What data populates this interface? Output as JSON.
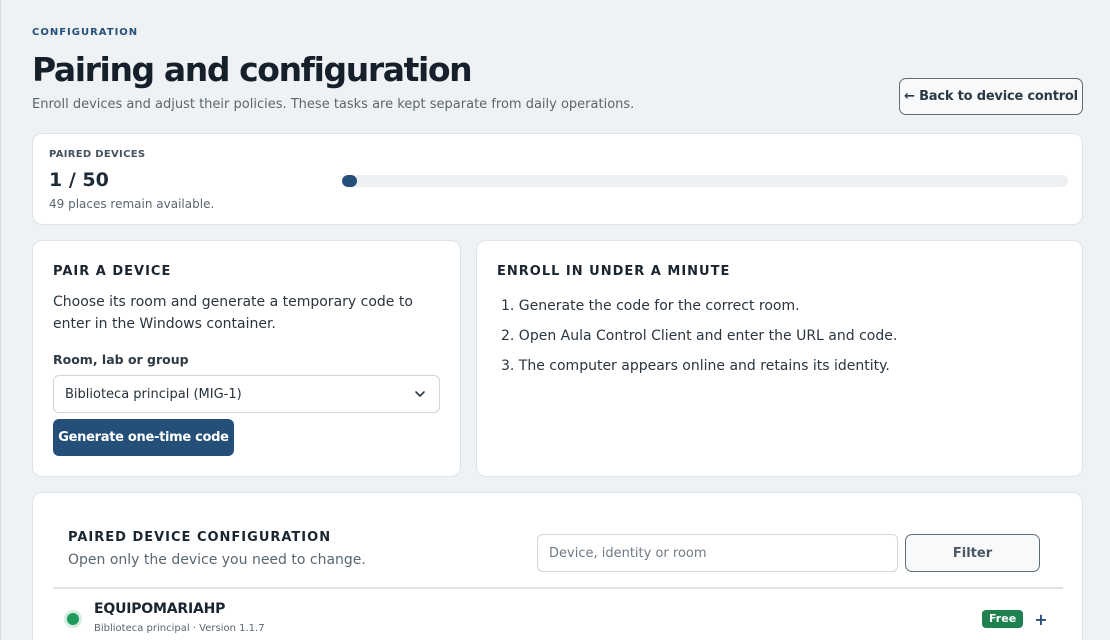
{
  "header": {
    "eyebrow": "CONFIGURATION",
    "title": "Pairing and configuration",
    "subtitle": "Enroll devices and adjust their policies. These tasks are kept separate from daily operations.",
    "back_label": "← Back to device control"
  },
  "stats": {
    "label": "PAIRED DEVICES",
    "value": "1 / 50",
    "note": "49 places remain available.",
    "paired": 1,
    "capacity": 50,
    "accent": "#244f78"
  },
  "pair": {
    "heading": "PAIR A DEVICE",
    "description": "Choose its room and generate a temporary code to enter in the Windows container.",
    "field_label": "Room, lab or group",
    "selected_room": "Biblioteca principal (MIG-1)",
    "button_label": "Generate one-time code"
  },
  "enroll": {
    "heading": "ENROLL IN UNDER A MINUTE",
    "steps": [
      "1. Generate the code for the correct room.",
      "2. Open Aula Control Client and enter the URL and code.",
      "3. The computer appears online and retains its identity."
    ]
  },
  "config": {
    "heading": "PAIRED DEVICE CONFIGURATION",
    "subtitle": "Open only the device you need to change.",
    "search_placeholder": "Device, identity or room",
    "filter_label": "Filter",
    "devices": [
      {
        "name": "EQUIPOMARIAHP",
        "meta": "Biblioteca principal · Version 1.1.7",
        "badge": "Free",
        "expand_symbol": "+",
        "status_color": "#1f9a5a",
        "badge_color": "#1f8050"
      }
    ]
  }
}
